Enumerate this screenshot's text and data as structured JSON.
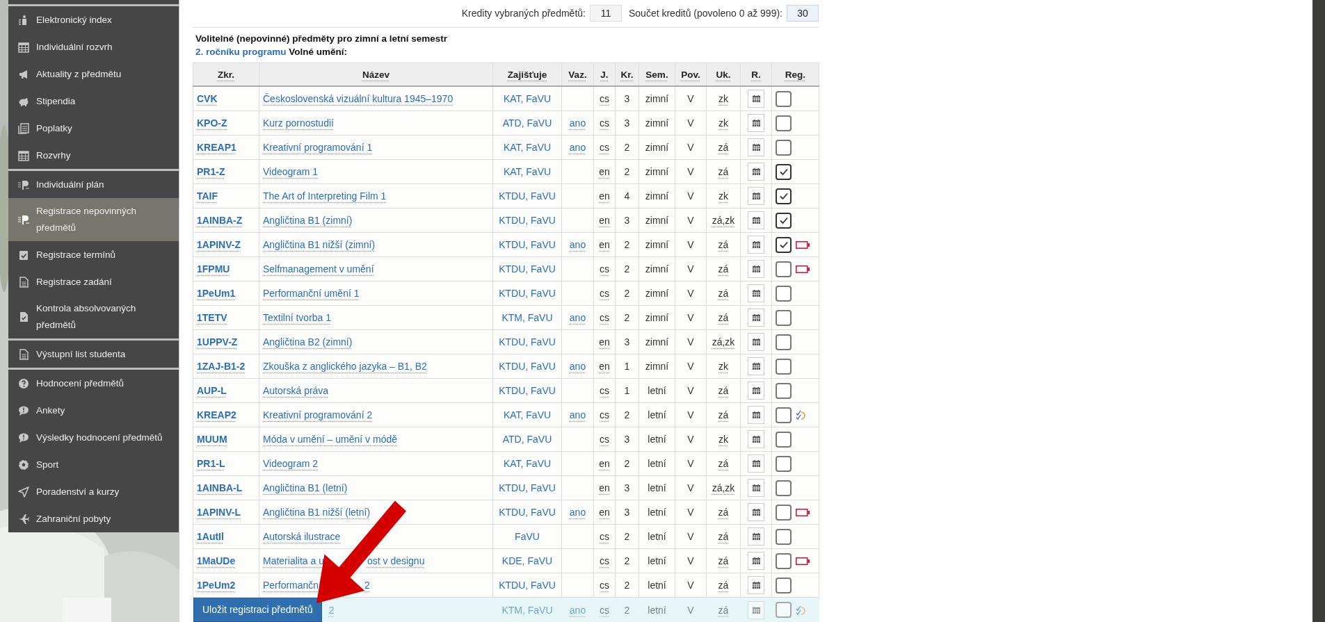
{
  "sidebar": {
    "groups": [
      {
        "items": [
          {
            "label": "Elektronický index",
            "selected": false
          },
          {
            "label": "Individuální rozvrh",
            "selected": false
          },
          {
            "label": "Aktuality z předmětu",
            "selected": false
          },
          {
            "label": "Stipendia",
            "selected": false
          },
          {
            "label": "Poplatky",
            "selected": false
          },
          {
            "label": "Rozvrhy",
            "selected": false
          }
        ]
      },
      {
        "items": [
          {
            "label": "Individuální plán",
            "selected": false
          },
          {
            "label": "Registrace nepovinných předmětů",
            "selected": true
          },
          {
            "label": "Registrace termínů",
            "selected": false
          },
          {
            "label": "Registrace zadání",
            "selected": false
          },
          {
            "label": "Kontrola absolvovaných předmětů",
            "selected": false
          }
        ]
      },
      {
        "items": [
          {
            "label": "Výstupní list studenta",
            "selected": false
          }
        ]
      },
      {
        "items": [
          {
            "label": "Hodnocení předmětů",
            "selected": false
          },
          {
            "label": "Ankety",
            "selected": false
          },
          {
            "label": "Výsledky hodnocení předmětů",
            "selected": false
          },
          {
            "label": "Sport",
            "selected": false
          },
          {
            "label": "Poradenství a kurzy",
            "selected": false
          },
          {
            "label": "Zahraniční pobyty",
            "selected": false
          }
        ]
      }
    ]
  },
  "credits": {
    "selected_label": "Kredity vybraných předmětů:",
    "selected_value": "11",
    "total_label": "Součet kreditů (povoleno 0 až 999):",
    "total_value": "30"
  },
  "heading": {
    "title": "Volitelné (nepovinné) předměty pro zimní a letní semestr",
    "link": "2. ročníku programu",
    "suffix": "Volné umění:"
  },
  "table": {
    "columns": [
      "Zkr.",
      "Název",
      "Zajišťuje",
      "Vaz.",
      "J.",
      "Kr.",
      "Sem.",
      "Pov.",
      "Uk.",
      "R.",
      "Reg."
    ],
    "rows": [
      {
        "code": "CVK",
        "name": "Československá vizuální kultura 1945–1970",
        "department": "KAT, FaVU",
        "language": "cs",
        "credits": "3",
        "semester": "zimní",
        "mandatory": "V",
        "completion": "zk",
        "registered": false
      },
      {
        "code": "KPO-Z",
        "name": "Kurz pornostudií",
        "department": "ATD, FaVU",
        "binding": "ano",
        "language": "cs",
        "credits": "3",
        "semester": "zimní",
        "mandatory": "V",
        "completion": "zk",
        "registered": false
      },
      {
        "code": "KREAP1",
        "name": "Kreativní programování 1",
        "department": "KAT, FaVU",
        "binding": "ano",
        "language": "cs",
        "credits": "2",
        "semester": "zimní",
        "mandatory": "V",
        "completion": "zá",
        "registered": false
      },
      {
        "code": "PR1-Z",
        "name": "Videogram 1",
        "department": "KAT, FaVU",
        "language": "en",
        "credits": "2",
        "semester": "zimní",
        "mandatory": "V",
        "completion": "zá",
        "registered": true
      },
      {
        "code": "TAIF",
        "name": "The Art of Interpreting Film 1",
        "department": "KTDU, FaVU",
        "language": "en",
        "credits": "4",
        "semester": "zimní",
        "mandatory": "V",
        "completion": "zk",
        "registered": true
      },
      {
        "code": "1AINBA-Z",
        "name": "Angličtina B1 (zimní)",
        "department": "KTDU, FaVU",
        "language": "en",
        "credits": "3",
        "semester": "zimní",
        "mandatory": "V",
        "completion": "zá,zk",
        "registered": true
      },
      {
        "code": "1APINV-Z",
        "name": "Angličtina B1 nižší (zimní)",
        "department": "KTDU, FaVU",
        "binding": "ano",
        "language": "en",
        "credits": "2",
        "semester": "zimní",
        "mandatory": "V",
        "completion": "zá",
        "registered": true,
        "full": true
      },
      {
        "code": "1FPMU",
        "name": "Selfmanagement v umění",
        "department": "KTDU, FaVU",
        "language": "cs",
        "credits": "2",
        "semester": "zimní",
        "mandatory": "V",
        "completion": "zá",
        "registered": false,
        "full": true
      },
      {
        "code": "1PeUm1",
        "name": "Performanční umění 1",
        "department": "KTDU, FaVU",
        "language": "cs",
        "credits": "2",
        "semester": "zimní",
        "mandatory": "V",
        "completion": "zá",
        "registered": false
      },
      {
        "code": "1TETV",
        "name": "Textilní tvorba 1",
        "department": "KTM, FaVU",
        "binding": "ano",
        "language": "cs",
        "credits": "2",
        "semester": "zimní",
        "mandatory": "V",
        "completion": "zá",
        "registered": false
      },
      {
        "code": "1UPPV-Z",
        "name": "Angličtina B2 (zimní)",
        "department": "KTDU, FaVU",
        "language": "en",
        "credits": "3",
        "semester": "zimní",
        "mandatory": "V",
        "completion": "zá,zk",
        "registered": false
      },
      {
        "code": "1ZAJ-B1-2",
        "name": "Zkouška z anglického jazyka – B1, B2",
        "department": "KTDU, FaVU",
        "binding": "ano",
        "language": "en",
        "credits": "1",
        "semester": "zimní",
        "mandatory": "V",
        "completion": "zk",
        "registered": false
      },
      {
        "code": "AUP-L",
        "name": "Autorská práva",
        "department": "KTDU, FaVU",
        "language": "cs",
        "credits": "1",
        "semester": "letní",
        "mandatory": "V",
        "completion": "zá",
        "registered": false
      },
      {
        "code": "KREAP2",
        "name": "Kreativní programování 2",
        "department": "KAT, FaVU",
        "binding": "ano",
        "language": "cs",
        "credits": "2",
        "semester": "letní",
        "mandatory": "V",
        "completion": "zá",
        "registered": false,
        "pending": true
      },
      {
        "code": "MUUM",
        "name": "Móda v umění – umění v módě",
        "department": "ATD, FaVU",
        "language": "cs",
        "credits": "3",
        "semester": "letní",
        "mandatory": "V",
        "completion": "zk",
        "registered": false
      },
      {
        "code": "PR1-L",
        "name": "Videogram 2",
        "department": "KAT, FaVU",
        "language": "en",
        "credits": "2",
        "semester": "letní",
        "mandatory": "V",
        "completion": "zá",
        "registered": false
      },
      {
        "code": "1AINBA-L",
        "name": "Angličtina B1 (letní)",
        "department": "KTDU, FaVU",
        "language": "en",
        "credits": "3",
        "semester": "letní",
        "mandatory": "V",
        "completion": "zá,zk",
        "registered": false
      },
      {
        "code": "1APINV-L",
        "name": "Angličtina B1 nižší (letní)",
        "department": "KTDU, FaVU",
        "binding": "ano",
        "language": "en",
        "credits": "3",
        "semester": "letní",
        "mandatory": "V",
        "completion": "zá",
        "registered": false,
        "full": true
      },
      {
        "code": "1AutIl",
        "name": "Autorská ilustrace",
        "department": "FaVU",
        "language": "cs",
        "credits": "2",
        "semester": "letní",
        "mandatory": "V",
        "completion": "zá",
        "registered": false
      },
      {
        "code": "1MaUDe",
        "name": "Materialita a u",
        "department": "KDE, FaVU",
        "language": "cs",
        "credits": "2",
        "semester": "letní",
        "mandatory": "V",
        "completion": "zá",
        "registered": false,
        "full": true,
        "name_tail": "ost v designu"
      },
      {
        "code": "1PeUm2",
        "name": "Performanční",
        "department": "KTDU, FaVU",
        "language": "cs",
        "credits": "2",
        "semester": "letní",
        "mandatory": "V",
        "completion": "zá",
        "registered": false,
        "name_tail": "2"
      }
    ]
  },
  "save_bar": {
    "button": "Uložit registraci předmětů",
    "row": {
      "name": "2",
      "department": "KTM, FaVU",
      "binding": "ano",
      "language": "cs",
      "credits": "2",
      "semester": "letní",
      "mandatory": "V",
      "completion": "zá",
      "registered": false,
      "pending": true
    }
  }
}
